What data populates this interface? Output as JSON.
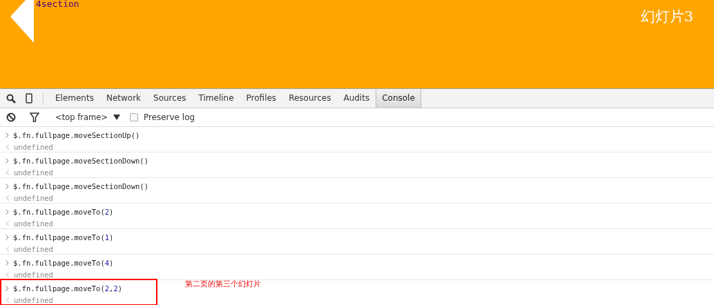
{
  "slide": {
    "label": "4section",
    "title": "幻灯片3"
  },
  "devtools": {
    "tabs": [
      {
        "label": "Elements",
        "selected": false
      },
      {
        "label": "Network",
        "selected": false
      },
      {
        "label": "Sources",
        "selected": false
      },
      {
        "label": "Timeline",
        "selected": false
      },
      {
        "label": "Profiles",
        "selected": false
      },
      {
        "label": "Resources",
        "selected": false
      },
      {
        "label": "Audits",
        "selected": false
      },
      {
        "label": "Console",
        "selected": true
      }
    ],
    "frame": "<top frame>",
    "preserve_log": {
      "label": "Preserve log",
      "checked": false
    }
  },
  "console": [
    {
      "parts": [
        {
          "kind": "code",
          "text": "$.fn.fullpage.moveSectionUp()"
        }
      ],
      "result": "undefined"
    },
    {
      "parts": [
        {
          "kind": "code",
          "text": "$.fn.fullpage.moveSectionDown()"
        }
      ],
      "result": "undefined"
    },
    {
      "parts": [
        {
          "kind": "code",
          "text": "$.fn.fullpage.moveSectionDown()"
        }
      ],
      "result": "undefined"
    },
    {
      "parts": [
        {
          "kind": "code",
          "text": "$.fn.fullpage.moveTo("
        },
        {
          "kind": "number",
          "text": "2"
        },
        {
          "kind": "code",
          "text": ")"
        }
      ],
      "result": "undefined"
    },
    {
      "parts": [
        {
          "kind": "code",
          "text": "$.fn.fullpage.moveTo("
        },
        {
          "kind": "number",
          "text": "1"
        },
        {
          "kind": "code",
          "text": ")"
        }
      ],
      "result": "undefined"
    },
    {
      "parts": [
        {
          "kind": "code",
          "text": "$.fn.fullpage.moveTo("
        },
        {
          "kind": "number",
          "text": "4"
        },
        {
          "kind": "code",
          "text": ")"
        }
      ],
      "result": "undefined"
    },
    {
      "parts": [
        {
          "kind": "code",
          "text": "$.fn.fullpage.moveTo("
        },
        {
          "kind": "number",
          "text": "2"
        },
        {
          "kind": "code",
          "text": ","
        },
        {
          "kind": "number",
          "text": "2"
        },
        {
          "kind": "code",
          "text": ")"
        }
      ],
      "result": "undefined",
      "note": "第二页的第三个幻灯片"
    }
  ]
}
